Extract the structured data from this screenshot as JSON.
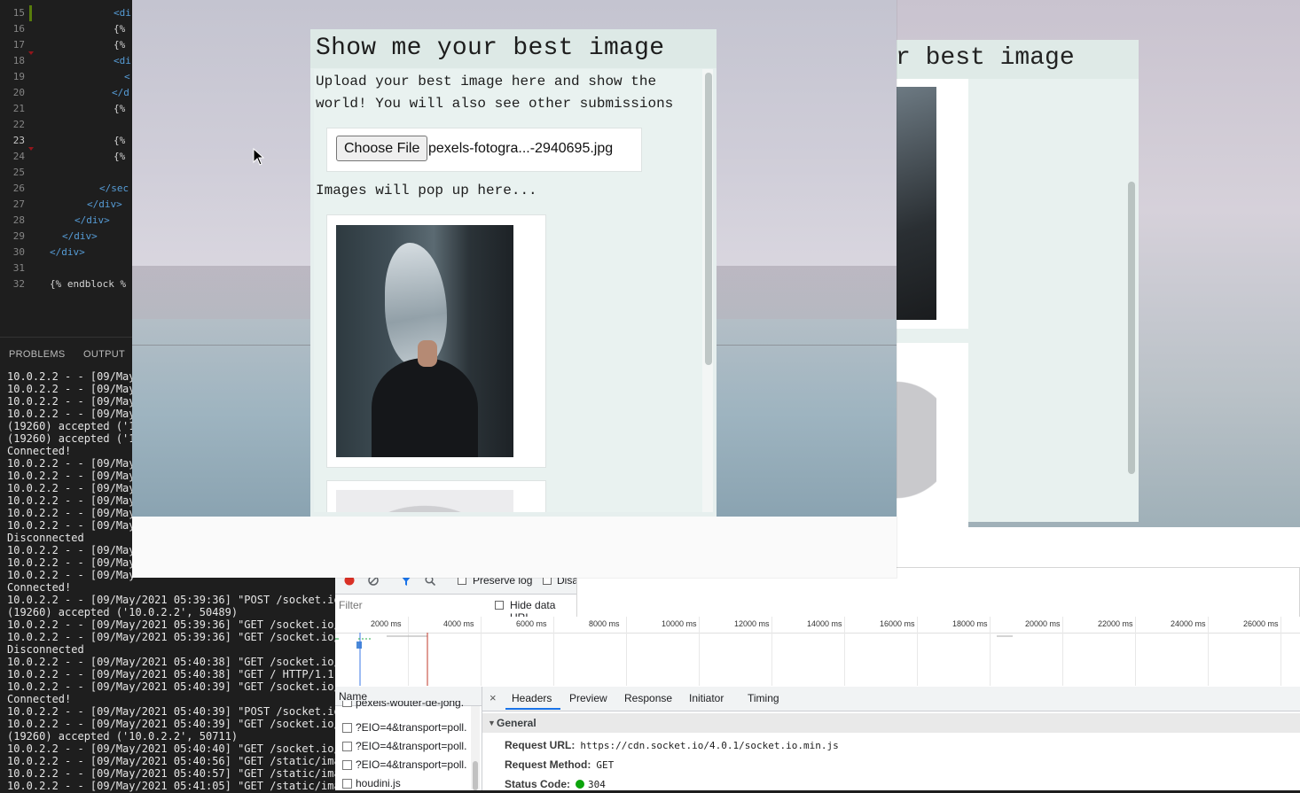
{
  "editor": {
    "lines": [
      {
        "num": "15",
        "code": "<di"
      },
      {
        "num": "16",
        "code": "{%"
      },
      {
        "num": "17",
        "code": "{%"
      },
      {
        "num": "18",
        "code": "<di"
      },
      {
        "num": "19",
        "code": "<"
      },
      {
        "num": "20",
        "code": "</d"
      },
      {
        "num": "21",
        "code": "{%"
      },
      {
        "num": "22",
        "code": ""
      },
      {
        "num": "23",
        "code": "{%"
      },
      {
        "num": "24",
        "code": "{%"
      },
      {
        "num": "25",
        "code": ""
      },
      {
        "num": "26",
        "code": "</sec"
      },
      {
        "num": "27",
        "code": "</div>"
      },
      {
        "num": "28",
        "code": "</div>"
      },
      {
        "num": "29",
        "code": "</div>"
      },
      {
        "num": "30",
        "code": "</div>"
      },
      {
        "num": "31",
        "code": ""
      },
      {
        "num": "32",
        "code": "{% endblock %"
      }
    ]
  },
  "panel": {
    "tabs": [
      "PROBLEMS",
      "OUTPUT"
    ],
    "terminal_lines": [
      "10.0.2.2 - - [09/May",
      "10.0.2.2 - - [09/May",
      "10.0.2.2 - - [09/May",
      "10.0.2.2 - - [09/May",
      "(19260) accepted ('1",
      "(19260) accepted ('1",
      "Connected!",
      "10.0.2.2 - - [09/May",
      "10.0.2.2 - - [09/May",
      "10.0.2.2 - - [09/May",
      "10.0.2.2 - - [09/May",
      "10.0.2.2 - - [09/May",
      "10.0.2.2 - - [09/May",
      "Disconnected",
      "10.0.2.2 - - [09/May",
      "10.0.2.2 - - [09/May",
      "10.0.2.2 - - [09/May",
      "Connected!",
      "10.0.2.2 - - [09/May/2021 05:39:36] \"POST /socket.io/",
      "(19260) accepted ('10.0.2.2', 50489)",
      "10.0.2.2 - - [09/May/2021 05:39:36] \"GET /socket.io/?",
      "10.0.2.2 - - [09/May/2021 05:39:36] \"GET /socket.io/?",
      "Disconnected",
      "10.0.2.2 - - [09/May/2021 05:40:38] \"GET /socket.io/?",
      "10.0.2.2 - - [09/May/2021 05:40:38] \"GET / HTTP/1.1\"",
      "10.0.2.2 - - [09/May/2021 05:40:39] \"GET /socket.io/?",
      "Connected!",
      "10.0.2.2 - - [09/May/2021 05:40:39] \"POST /socket.io/",
      "10.0.2.2 - - [09/May/2021 05:40:39] \"GET /socket.io/?",
      "(19260) accepted ('10.0.2.2', 50711)",
      "10.0.2.2 - - [09/May/2021 05:40:40] \"GET /socket.io/?",
      "10.0.2.2 - - [09/May/2021 05:40:56] \"GET /static/imag",
      "10.0.2.2 - - [09/May/2021 05:40:57] \"GET /static/imag",
      "10.0.2.2 - - [09/May/2021 05:41:05] \"GET /static/imag"
    ]
  },
  "app": {
    "title": "Show me your best image",
    "description": "Upload your best image here and show the world! You will also see other submissions",
    "choose_file_label": "Choose File",
    "file_name": "pexels-fotogra...-2940695.jpg",
    "pop_text": "Images will pop up here..."
  },
  "ghost": {
    "title_fragment": "r best image"
  },
  "devtools": {
    "preserve_log": "Preserve log",
    "disable_cache": "Disa",
    "filter_placeholder": "Filter",
    "hide_data_urls": "Hide data URL",
    "ticks": [
      "2000 ms",
      "4000 ms",
      "6000 ms",
      "8000 ms",
      "10000 ms",
      "12000 ms",
      "14000 ms",
      "16000 ms",
      "18000 ms",
      "20000 ms",
      "22000 ms",
      "24000 ms",
      "26000 ms"
    ],
    "name_header": "Name",
    "requests": [
      "pexels-wouter-de-jong.",
      "?EIO=4&transport=poll.",
      "?EIO=4&transport=poll.",
      "?EIO=4&transport=poll.",
      "houdini.js"
    ],
    "tabs": [
      "Headers",
      "Preview",
      "Response",
      "Initiator",
      "Timing"
    ],
    "close": "×",
    "general_label": "General",
    "request_url_key": "Request URL:",
    "request_url": "https://cdn.socket.io/4.0.1/socket.io.min.js",
    "request_method_key": "Request Method:",
    "request_method": "GET",
    "status_code_key": "Status Code:",
    "status_code": "304"
  }
}
